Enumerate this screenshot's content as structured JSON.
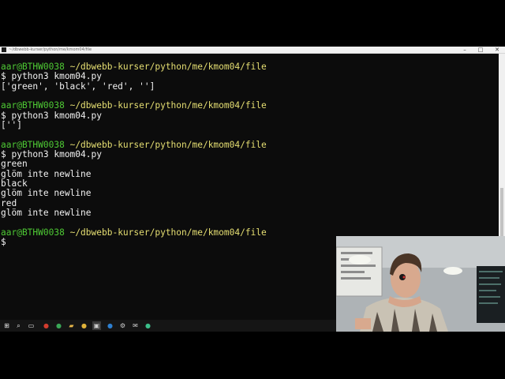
{
  "window": {
    "title": "~/dbwebb-kurser/python/me/kmom04/file",
    "minimize_glyph": "–",
    "maximize_glyph": "□",
    "close_glyph": "✕"
  },
  "terminal": {
    "lines": [
      {
        "segments": [
          {
            "text": "aar@BTHW0038",
            "color": "green"
          },
          {
            "text": " ",
            "color": "white"
          },
          {
            "text": "~/dbwebb-kurser/python/me/kmom04/file",
            "color": "yellow"
          }
        ]
      },
      {
        "segments": [
          {
            "text": "$ python3 kmom04.py",
            "color": "white"
          }
        ]
      },
      {
        "segments": [
          {
            "text": "['green', 'black', 'red', '']",
            "color": "white"
          }
        ]
      },
      {
        "segments": []
      },
      {
        "segments": [
          {
            "text": "aar@BTHW0038",
            "color": "green"
          },
          {
            "text": " ",
            "color": "white"
          },
          {
            "text": "~/dbwebb-kurser/python/me/kmom04/file",
            "color": "yellow"
          }
        ]
      },
      {
        "segments": [
          {
            "text": "$ python3 kmom04.py",
            "color": "white"
          }
        ]
      },
      {
        "segments": [
          {
            "text": "['']",
            "color": "white"
          }
        ]
      },
      {
        "segments": []
      },
      {
        "segments": [
          {
            "text": "aar@BTHW0038",
            "color": "green"
          },
          {
            "text": " ",
            "color": "white"
          },
          {
            "text": "~/dbwebb-kurser/python/me/kmom04/file",
            "color": "yellow"
          }
        ]
      },
      {
        "segments": [
          {
            "text": "$ python3 kmom04.py",
            "color": "white"
          }
        ]
      },
      {
        "segments": [
          {
            "text": "green",
            "color": "white"
          }
        ]
      },
      {
        "segments": [
          {
            "text": "glöm inte newline",
            "color": "white"
          }
        ]
      },
      {
        "segments": [
          {
            "text": "black",
            "color": "white"
          }
        ]
      },
      {
        "segments": [
          {
            "text": "glöm inte newline",
            "color": "white"
          }
        ]
      },
      {
        "segments": [
          {
            "text": "red",
            "color": "white"
          }
        ]
      },
      {
        "segments": [
          {
            "text": "glöm inte newline",
            "color": "white"
          }
        ]
      },
      {
        "segments": []
      },
      {
        "segments": [
          {
            "text": "aar@BTHW0038",
            "color": "green"
          },
          {
            "text": " ",
            "color": "white"
          },
          {
            "text": "~/dbwebb-kurser/python/me/kmom04/file",
            "color": "yellow"
          }
        ]
      },
      {
        "segments": [
          {
            "text": "$",
            "color": "white"
          }
        ]
      }
    ]
  },
  "taskbar": {
    "items": [
      {
        "name": "start-menu-icon",
        "glyph": "⊞",
        "active": false
      },
      {
        "name": "search-icon",
        "glyph": "⌕",
        "active": false
      },
      {
        "name": "task-view-icon",
        "glyph": "▭",
        "active": false
      },
      {
        "name": "app-icon-red",
        "glyph": "●",
        "color": "#d23c2e",
        "active": false
      },
      {
        "name": "app-icon-green",
        "glyph": "●",
        "color": "#3aa757",
        "active": false
      },
      {
        "name": "file-explorer-icon",
        "glyph": "▰",
        "color": "#e8b84a",
        "active": false
      },
      {
        "name": "chrome-icon",
        "glyph": "●",
        "color": "#e0b33a",
        "active": false
      },
      {
        "name": "terminal-icon",
        "glyph": "▣",
        "color": "#cfcfcf",
        "active": true
      },
      {
        "name": "app-icon-blue",
        "glyph": "●",
        "color": "#2d7fd0",
        "active": false
      },
      {
        "name": "settings-icon",
        "glyph": "⚙",
        "color": "#d0d0d0",
        "active": false
      },
      {
        "name": "mail-icon",
        "glyph": "✉",
        "color": "#d0d0d0",
        "active": false
      },
      {
        "name": "app-icon-teal",
        "glyph": "●",
        "color": "#3bbf8a",
        "active": false
      }
    ]
  },
  "colors": {
    "green": "#4ec934",
    "yellow": "#e6df72",
    "white": "#f2f2f2"
  }
}
